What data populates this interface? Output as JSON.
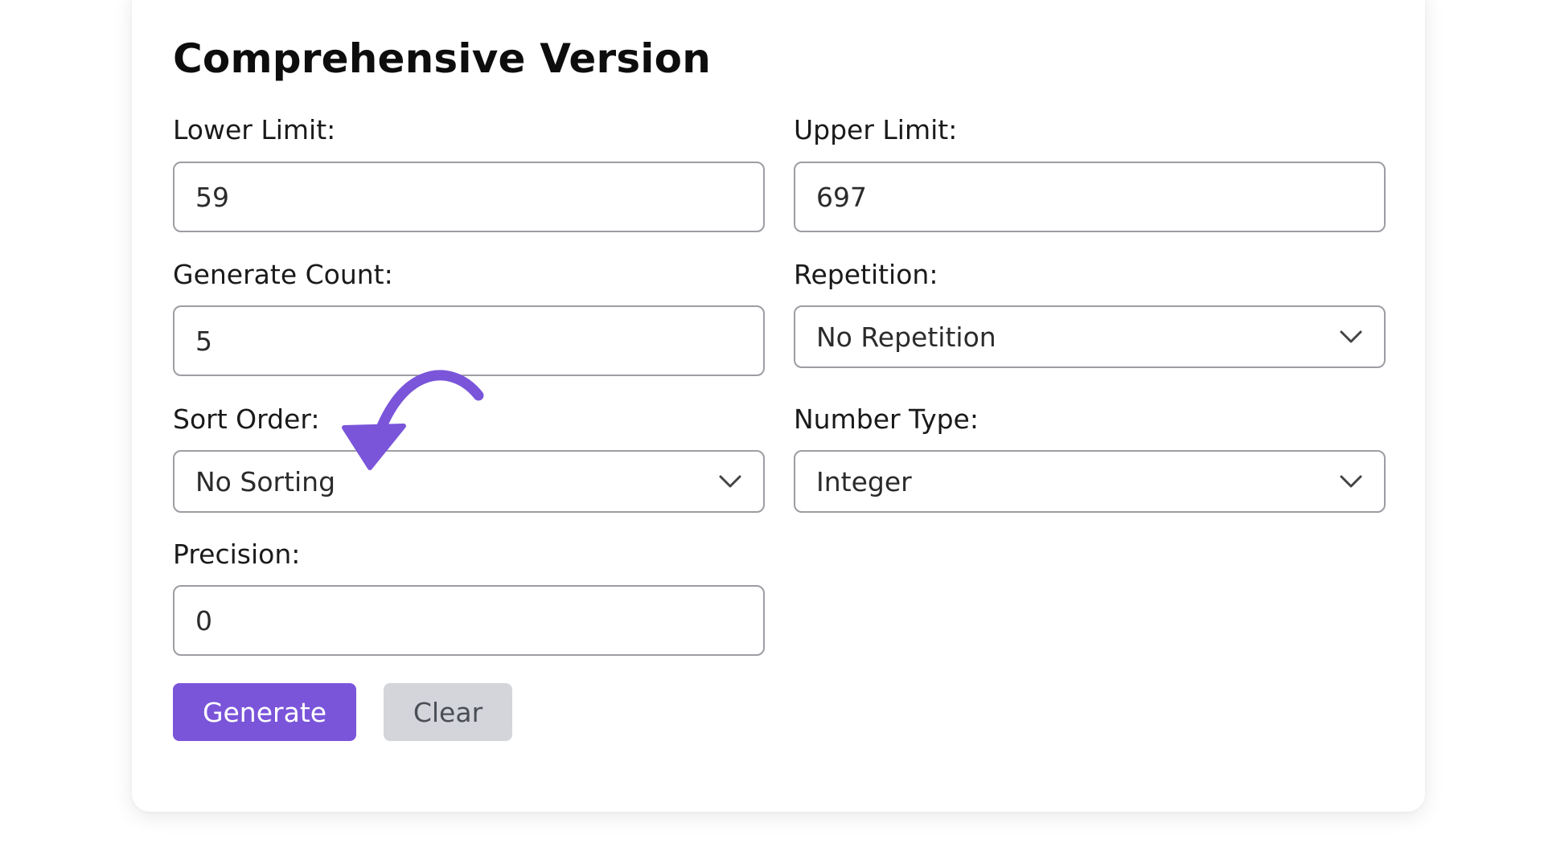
{
  "form": {
    "title": "Comprehensive Version",
    "lower_limit": {
      "label": "Lower Limit:",
      "value": "59"
    },
    "upper_limit": {
      "label": "Upper Limit:",
      "value": "697"
    },
    "generate_count": {
      "label": "Generate Count:",
      "value": "5"
    },
    "repetition": {
      "label": "Repetition:",
      "selected": "No Repetition"
    },
    "sort_order": {
      "label": "Sort Order:",
      "selected": "No Sorting"
    },
    "number_type": {
      "label": "Number Type:",
      "selected": "Integer"
    },
    "precision": {
      "label": "Precision:",
      "value": "0"
    }
  },
  "buttons": {
    "generate_label": "Generate",
    "clear_label": "Clear"
  },
  "icons": {
    "select_arrow": "chevron-down-icon",
    "pointer": "curved-arrow-icon"
  },
  "colors": {
    "accent": "#7a55d9",
    "clear_bg": "#d4d5da",
    "arrow": "#7a55d9"
  }
}
